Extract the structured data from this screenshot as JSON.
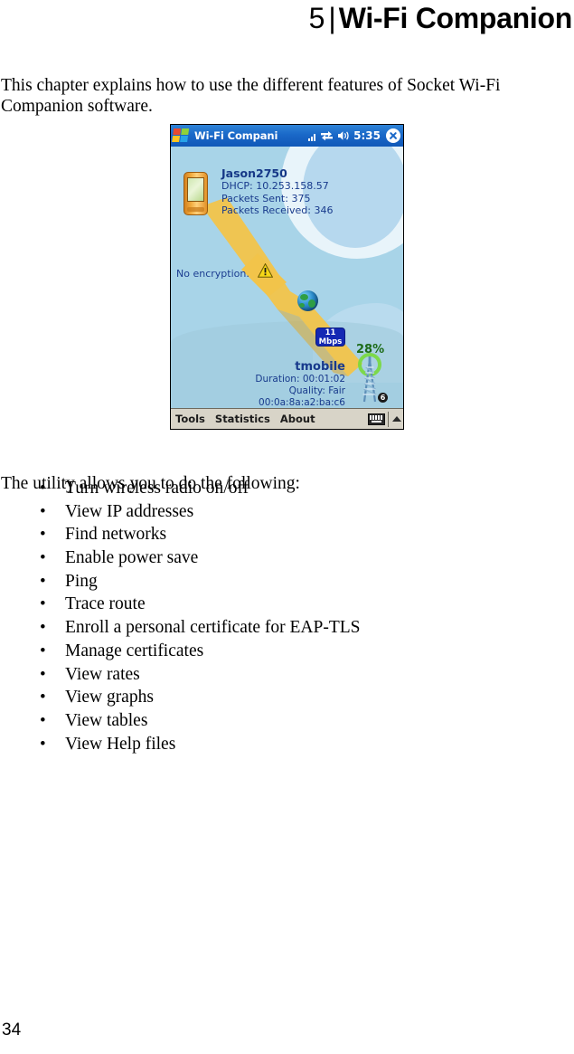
{
  "chapter": {
    "number": "5",
    "separator": "|",
    "title": "Wi-Fi Companion"
  },
  "intro_paragraph": "This chapter explains how to use the different features of Socket Wi-Fi Companion software.",
  "list_lead_in": "The utility allows you to do the following:",
  "bullet_marker": "•",
  "features": [
    "Turn wireless radio on/off",
    "View IP addresses",
    "Find networks",
    "Enable power save",
    "Ping",
    "Trace route",
    "Enroll a personal certificate for EAP-TLS",
    "Manage certificates",
    "View rates",
    "View graphs",
    "View tables",
    "View Help files"
  ],
  "page_number": "34",
  "screenshot": {
    "titlebar": {
      "start_icon": "windows-flag-icon",
      "title": "Wi-Fi Companion",
      "signal_icon": "signal-bars-icon",
      "connection_icon": "network-connection-icon",
      "volume_icon": "speaker-icon",
      "time": "5:35",
      "close_icon": "close-x-icon"
    },
    "client": {
      "device_icon": "pda-device-icon",
      "ssid": "Jason2750",
      "dhcp": "DHCP: 10.253.158.57",
      "packets_sent": "Packets Sent: 375",
      "packets_received": "Packets Received: 346",
      "encryption": "No encryption.",
      "warning_icon": "warning-triangle-icon"
    },
    "link": {
      "globe_icon": "internet-globe-icon",
      "rate_value": "11",
      "rate_unit": "Mbps",
      "signal_percent": "28%"
    },
    "access_point": {
      "name": "tmobile",
      "duration": "Duration: 00:01:02",
      "quality": "Quality: Fair",
      "mac_address": "00:0a:8a:a2:ba:c6",
      "tower_icon": "antenna-tower-icon",
      "channel_badge": "6"
    },
    "toolbar": {
      "tools": "Tools",
      "statistics": "Statistics",
      "about": "About",
      "keyboard_icon": "soft-keyboard-icon",
      "expand_icon": "up-arrow-icon"
    }
  },
  "colors": {
    "titlebar_blue": "#1a68c8",
    "canvas_blue": "#a8d4e8",
    "info_text_blue": "#183a8c",
    "beam_yellow": "#f2c44a",
    "rate_badge_blue": "#1428b4",
    "percent_green": "#1d6b18",
    "toolbar_grey": "#d8d4c8"
  }
}
